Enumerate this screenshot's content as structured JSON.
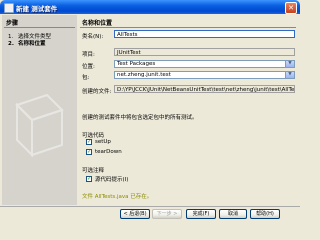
{
  "window": {
    "title": "新建 测试套件",
    "close_glyph": "✕"
  },
  "steps": {
    "header": "步骤",
    "items": [
      {
        "num": "1.",
        "label": "选择文件类型"
      },
      {
        "num": "2.",
        "label": "名称和位置"
      }
    ]
  },
  "pane": {
    "header": "名称和位置",
    "class_name_label": "类名(N):",
    "class_name_value": "AllTests",
    "project_label": "项目:",
    "project_value": "JUnitTest",
    "location_label": "位置:",
    "location_value": "Test Packages",
    "package_label": "包:",
    "package_value": "net.zheng.junit.test",
    "created_file_label": "创建的文件:",
    "created_file_value": "D:\\YP\\JCCK\\JUnit\\NetBeansUnitTest\\test\\net\\zheng\\junit\\test\\AllTests.java",
    "description": "创建的测试套件中将包含选定包中的所有测试。",
    "optional_code_title": "可选代码",
    "optional_code": [
      {
        "label": "setUp",
        "checked": true
      },
      {
        "label": "tearDown",
        "checked": true
      }
    ],
    "optional_comments_title": "可选注释",
    "optional_comments": [
      {
        "label": "源代码提示(I)",
        "checked": true
      }
    ],
    "warning": "文件 AllTests.java 已存在。"
  },
  "buttons": {
    "back": "< 后退(B)",
    "next": "下一步 >",
    "finish": "完成(F)",
    "cancel": "取消",
    "help": "帮助(H)"
  }
}
